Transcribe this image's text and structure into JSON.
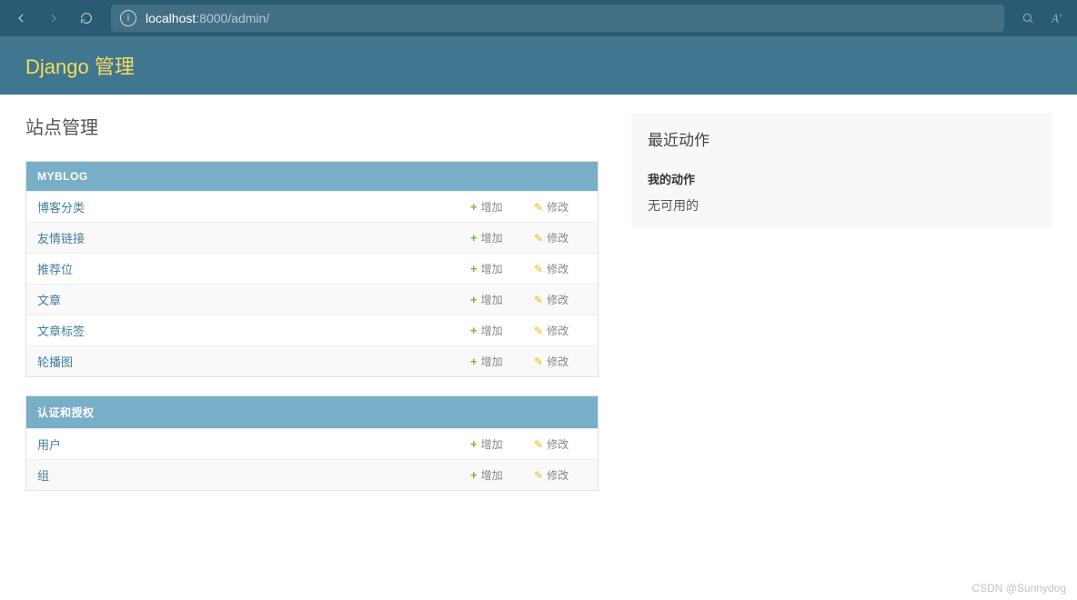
{
  "browser": {
    "host": "localhost",
    "port": ":8000",
    "path": "/admin/"
  },
  "header": {
    "title": "Django 管理"
  },
  "page": {
    "title": "站点管理"
  },
  "modules": [
    {
      "label": "MYBLOG",
      "rows": [
        {
          "name": "博客分类"
        },
        {
          "name": "友情链接"
        },
        {
          "name": "推荐位"
        },
        {
          "name": "文章"
        },
        {
          "name": "文章标签"
        },
        {
          "name": "轮播图"
        }
      ]
    },
    {
      "label": "认证和授权",
      "rows": [
        {
          "name": "用户"
        },
        {
          "name": "组"
        }
      ]
    }
  ],
  "actions": {
    "add_label": "增加",
    "change_label": "修改"
  },
  "sidebar": {
    "title": "最近动作",
    "subtitle": "我的动作",
    "empty": "无可用的"
  },
  "watermark": "CSDN @Sunnydog"
}
